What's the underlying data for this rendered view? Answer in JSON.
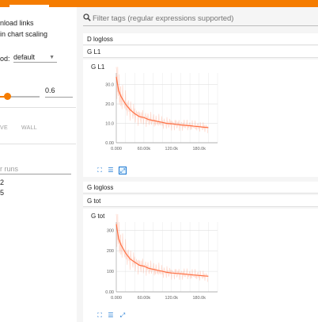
{
  "sidebar": {
    "download_links": "nload links",
    "chart_scaling": "in chart scaling",
    "method_label": "od:",
    "method_value": "default",
    "smoothing_value": "0.6",
    "toggle_relative": "VE",
    "toggle_wall": "WALL",
    "runs_placeholder": "r runs",
    "run_1": "2",
    "run_2": "5"
  },
  "main": {
    "search_placeholder": "Filter tags (regular expressions supported)",
    "categories": [
      "D logloss",
      "G L1",
      "G logloss",
      "G tot"
    ]
  },
  "charts": [
    {
      "title": "G L1",
      "y_ticks": [
        "30.0",
        "20.0",
        "10.0",
        "0.00"
      ],
      "x_ticks": [
        "0.000",
        "60.00k",
        "120.0k",
        "180.0k"
      ],
      "color": "#ff7043"
    },
    {
      "title": "G tot",
      "y_ticks": [
        "300",
        "200",
        "100",
        "0.00"
      ],
      "x_ticks": [
        "0.000",
        "60.00k",
        "120.0k",
        "180.0k"
      ],
      "color": "#ff7043"
    }
  ],
  "chart_data": [
    {
      "type": "line",
      "title": "G L1",
      "x": [
        0,
        5000,
        10000,
        20000,
        30000,
        40000,
        50000,
        60000,
        70000,
        80000,
        90000,
        100000,
        110000,
        120000,
        130000,
        140000,
        150000,
        160000,
        170000,
        180000,
        190000,
        200000
      ],
      "series": [
        {
          "values": [
            34,
            27,
            24,
            20,
            17,
            15,
            13.5,
            13,
            12,
            11.5,
            11,
            10.5,
            10,
            9.8,
            9.5,
            9.2,
            9,
            8.8,
            8.5,
            8.3,
            8,
            7.8
          ]
        }
      ],
      "xlim": [
        0,
        220000
      ],
      "ylim": [
        0,
        36
      ],
      "grid": true
    },
    {
      "type": "line",
      "title": "G tot",
      "x": [
        0,
        5000,
        10000,
        20000,
        30000,
        40000,
        50000,
        60000,
        70000,
        80000,
        90000,
        100000,
        110000,
        120000,
        130000,
        140000,
        150000,
        160000,
        170000,
        180000,
        190000,
        200000
      ],
      "series": [
        {
          "values": [
            330,
            260,
            230,
            190,
            160,
            145,
            130,
            125,
            115,
            110,
            105,
            100,
            95,
            92,
            90,
            88,
            86,
            84,
            82,
            80,
            78,
            76
          ]
        }
      ],
      "xlim": [
        0,
        220000
      ],
      "ylim": [
        0,
        340
      ],
      "grid": true
    }
  ]
}
